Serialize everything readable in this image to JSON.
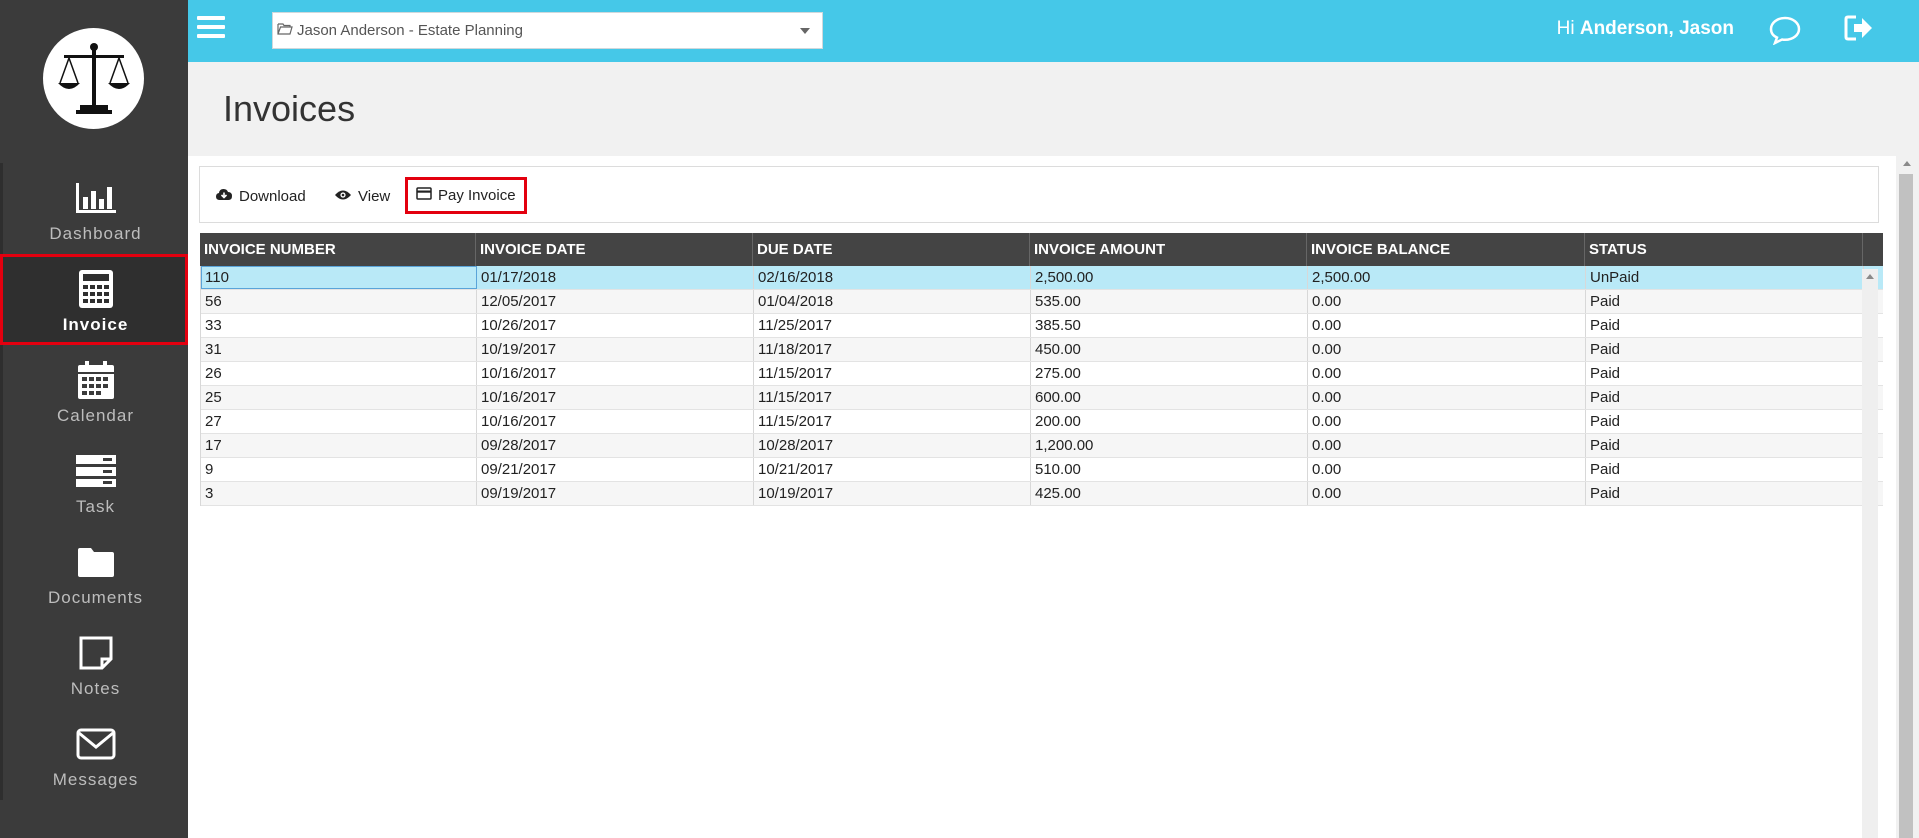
{
  "sidebar": {
    "logo_icon": "scales-of-justice-icon",
    "items": [
      {
        "label": "Dashboard",
        "icon": "bar-chart-icon",
        "active": false
      },
      {
        "label": "Invoice",
        "icon": "calculator-icon",
        "active": true
      },
      {
        "label": "Calendar",
        "icon": "calendar-icon",
        "active": false
      },
      {
        "label": "Task",
        "icon": "server-stack-icon",
        "active": false
      },
      {
        "label": "Documents",
        "icon": "folder-icon",
        "active": false
      },
      {
        "label": "Notes",
        "icon": "sticky-note-icon",
        "active": false
      },
      {
        "label": "Messages",
        "icon": "envelope-icon",
        "active": false
      }
    ]
  },
  "topbar": {
    "matter_select_value": "Jason Anderson - Estate Planning",
    "greeting_prefix": "Hi ",
    "user_name": "Anderson, Jason",
    "accent_color": "#45c8e8"
  },
  "page": {
    "title": "Invoices"
  },
  "toolbar": {
    "download_label": "Download",
    "view_label": "View",
    "pay_invoice_label": "Pay Invoice"
  },
  "grid": {
    "columns": [
      "INVOICE NUMBER",
      "INVOICE DATE",
      "DUE DATE",
      "INVOICE AMOUNT",
      "INVOICE BALANCE",
      "STATUS"
    ],
    "rows": [
      [
        "110",
        "01/17/2018",
        "02/16/2018",
        "2,500.00",
        "2,500.00",
        "UnPaid"
      ],
      [
        "56",
        "12/05/2017",
        "01/04/2018",
        "535.00",
        "0.00",
        "Paid"
      ],
      [
        "33",
        "10/26/2017",
        "11/25/2017",
        "385.50",
        "0.00",
        "Paid"
      ],
      [
        "31",
        "10/19/2017",
        "11/18/2017",
        "450.00",
        "0.00",
        "Paid"
      ],
      [
        "26",
        "10/16/2017",
        "11/15/2017",
        "275.00",
        "0.00",
        "Paid"
      ],
      [
        "25",
        "10/16/2017",
        "11/15/2017",
        "600.00",
        "0.00",
        "Paid"
      ],
      [
        "27",
        "10/16/2017",
        "11/15/2017",
        "200.00",
        "0.00",
        "Paid"
      ],
      [
        "17",
        "09/28/2017",
        "10/28/2017",
        "1,200.00",
        "0.00",
        "Paid"
      ],
      [
        "9",
        "09/21/2017",
        "10/21/2017",
        "510.00",
        "0.00",
        "Paid"
      ],
      [
        "3",
        "09/19/2017",
        "10/19/2017",
        "425.00",
        "0.00",
        "Paid"
      ]
    ],
    "selected_row": 0
  }
}
